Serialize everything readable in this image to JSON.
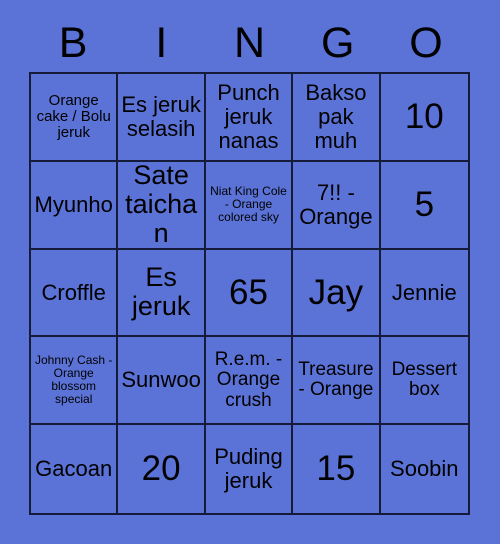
{
  "card": {
    "title": "BINGO",
    "background_color": "#5b73d7",
    "line_color": "#151b38",
    "text_color": "#000000",
    "columns": 5,
    "rows": 5
  },
  "header": {
    "letters": [
      "B",
      "I",
      "N",
      "G",
      "O"
    ]
  },
  "grid": {
    "cells": [
      {
        "text": "Orange cake / Bolu jeruk",
        "size": "xs"
      },
      {
        "text": "Es jeruk selasih",
        "size": "md"
      },
      {
        "text": "Punch jeruk nanas",
        "size": "md"
      },
      {
        "text": "Bakso pak muh",
        "size": "md"
      },
      {
        "text": "10",
        "size": "xl"
      },
      {
        "text": "Myunho",
        "size": "md"
      },
      {
        "text": "Sate taichan",
        "size": "lg"
      },
      {
        "text": "Niat King Cole - Orange colored sky",
        "size": "xxs"
      },
      {
        "text": "7!! - Orange",
        "size": "md"
      },
      {
        "text": "5",
        "size": "xl"
      },
      {
        "text": "Croffle",
        "size": "md"
      },
      {
        "text": "Es jeruk",
        "size": "lg"
      },
      {
        "text": "65",
        "size": "xl"
      },
      {
        "text": "Jay",
        "size": "xl"
      },
      {
        "text": "Jennie",
        "size": "md"
      },
      {
        "text": "Johnny Cash - Orange blossom special",
        "size": "xxs"
      },
      {
        "text": "Sunwoo",
        "size": "md"
      },
      {
        "text": "R.e.m. - Orange crush",
        "size": "sm"
      },
      {
        "text": "Treasure - Orange",
        "size": "sm"
      },
      {
        "text": "Dessert box",
        "size": "sm"
      },
      {
        "text": "Gacoan",
        "size": "md"
      },
      {
        "text": "20",
        "size": "xl"
      },
      {
        "text": "Puding jeruk",
        "size": "md"
      },
      {
        "text": "15",
        "size": "xl"
      },
      {
        "text": "Soobin",
        "size": "md"
      }
    ]
  }
}
